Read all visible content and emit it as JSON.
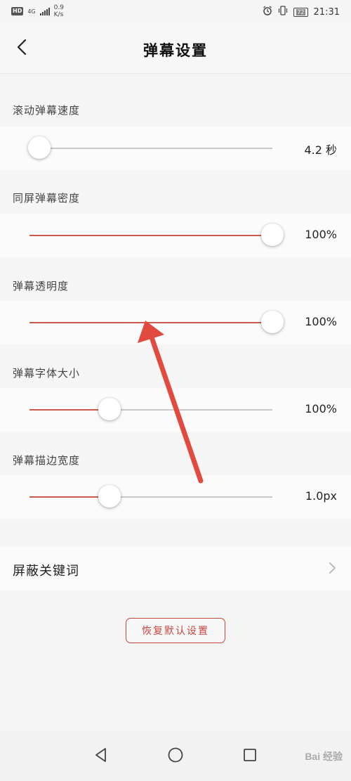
{
  "status_bar": {
    "hd": "HD",
    "network": "4G",
    "speed_value": "0.9",
    "speed_unit": "K/s",
    "battery": "72",
    "time": "21:31"
  },
  "header": {
    "title": "弹幕设置"
  },
  "settings": [
    {
      "label": "滚动弹幕速度",
      "value": "4.2 秒",
      "level": 0.04
    },
    {
      "label": "同屏弹幕密度",
      "value": "100%",
      "level": 1.0
    },
    {
      "label": "弹幕透明度",
      "value": "100%",
      "level": 1.0
    },
    {
      "label": "弹幕字体大小",
      "value": "100%",
      "level": 0.33
    },
    {
      "label": "弹幕描边宽度",
      "value": "1.0px",
      "level": 0.33
    }
  ],
  "block_keywords": {
    "label": "屏蔽关键词"
  },
  "reset_button": {
    "label": "恢复默认设置"
  },
  "colors": {
    "accent": "#cf5b4f",
    "annotation_arrow": "#e04a3f"
  },
  "watermark": {
    "text": "Bai 经验"
  },
  "icons": [
    "back-arrow-icon",
    "chevron-right-icon",
    "nav-back-icon",
    "nav-home-icon",
    "nav-recents-icon"
  ]
}
